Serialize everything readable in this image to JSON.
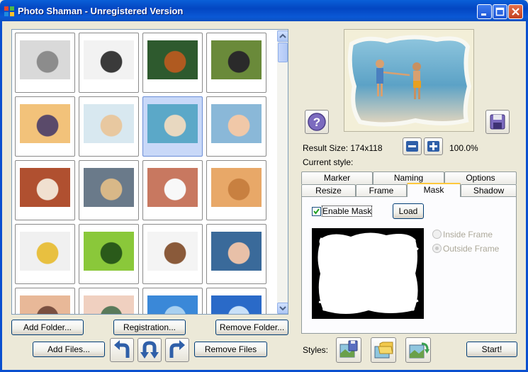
{
  "window": {
    "title": "Photo Shaman - Unregistered Version",
    "icon": "windows-flag-icon"
  },
  "gallery": {
    "thumbnails": [
      {
        "subject": "grey kitten",
        "colors": [
          "#D9D9D9",
          "#8C8C8C"
        ],
        "selected": false
      },
      {
        "subject": "dalmatian puppy",
        "colors": [
          "#F2F2F2",
          "#3A3A3A"
        ],
        "selected": false
      },
      {
        "subject": "baby orangutan",
        "colors": [
          "#2E5A2E",
          "#B05A20"
        ],
        "selected": false
      },
      {
        "subject": "gorilla",
        "colors": [
          "#6A8A3A",
          "#2A2A2A"
        ],
        "selected": false
      },
      {
        "subject": "beach sunset",
        "colors": [
          "#F2C27A",
          "#5A4A6A"
        ],
        "selected": false
      },
      {
        "subject": "seashell on beach",
        "colors": [
          "#D8E8F0",
          "#E8C8A0"
        ],
        "selected": false
      },
      {
        "subject": "children at sea",
        "colors": [
          "#5BA8C8",
          "#E8D8C0"
        ],
        "selected": true
      },
      {
        "subject": "baby on blanket",
        "colors": [
          "#8AB8D8",
          "#F0C8A8"
        ],
        "selected": false
      },
      {
        "subject": "beagle",
        "colors": [
          "#B05030",
          "#F0E0D0"
        ],
        "selected": false
      },
      {
        "subject": "puppies in basket",
        "colors": [
          "#6A7A8A",
          "#D8B888"
        ],
        "selected": false
      },
      {
        "subject": "white puppy",
        "colors": [
          "#C87860",
          "#F8F8F8"
        ],
        "selected": false
      },
      {
        "subject": "girl portrait",
        "colors": [
          "#E8A868",
          "#C88040"
        ],
        "selected": false
      },
      {
        "subject": "puppy and ducklings",
        "colors": [
          "#F0F0F0",
          "#E8C040"
        ],
        "selected": false
      },
      {
        "subject": "butterfly on flower",
        "colors": [
          "#8AC83A",
          "#2A5A1A"
        ],
        "selected": false
      },
      {
        "subject": "puppy in bucket",
        "colors": [
          "#F4F4F4",
          "#8A5A3A"
        ],
        "selected": false
      },
      {
        "subject": "baby face",
        "colors": [
          "#3A6A9A",
          "#E8C0A8"
        ],
        "selected": false
      },
      {
        "subject": "eyes close-up",
        "colors": [
          "#E8B898",
          "#7A5040"
        ],
        "selected": false
      },
      {
        "subject": "eye close-up",
        "colors": [
          "#F0D0C0",
          "#5A7A5A"
        ],
        "selected": false
      },
      {
        "subject": "blue flowers",
        "colors": [
          "#3A88D8",
          "#A8D0F0"
        ],
        "selected": false
      },
      {
        "subject": "water splash",
        "colors": [
          "#2A6AC8",
          "#C8E0F8"
        ],
        "selected": false
      }
    ],
    "buttons": {
      "add_folder": "Add Folder...",
      "registration": "Registration...",
      "remove_folder": "Remove Folder...",
      "add_files": "Add Files...",
      "remove_files": "Remove Files"
    }
  },
  "preview": {
    "result_size_label": "Result Size: 174x118",
    "zoom": "100.0%",
    "current_style_label": "Current style:"
  },
  "tabs": {
    "row1": [
      "Marker",
      "Naming",
      "Options"
    ],
    "row2": [
      "Resize",
      "Frame",
      "Mask",
      "Shadow"
    ],
    "active": "Mask"
  },
  "mask_panel": {
    "enable_mask_label": "Enable Mask",
    "enable_mask_checked": true,
    "load_label": "Load",
    "inside_frame_label": "Inside Frame",
    "outside_frame_label": "Outside Frame",
    "selected_option": "Outside Frame"
  },
  "styles": {
    "label": "Styles:",
    "start_label": "Start!"
  },
  "colors": {
    "titlebar": "#0A5FD8",
    "window_bg": "#ECE9D8",
    "tab_highlight": "#FFC83C",
    "selection": "#C8D8F8"
  }
}
